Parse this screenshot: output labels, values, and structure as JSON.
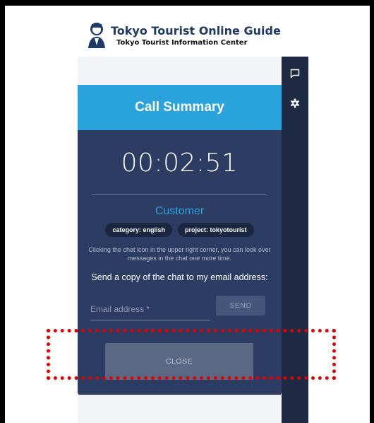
{
  "logo": {
    "title": "Tokyo Tourist Online Guide",
    "subtitle": "Tokyo Tourist Information Center"
  },
  "rail": {
    "chat_icon": "chat-bubble-icon",
    "settings_icon": "gear-icon"
  },
  "summary": {
    "title": "Call Summary",
    "duration": "00:02:51",
    "role": "Customer",
    "tags": [
      "category: english",
      "project: tokyotourist"
    ],
    "hint": "Clicking the chat icon in the upper right corner, you can look over messages in the chat one more time.",
    "send_copy_label": "Send a copy of the chat to my email address:",
    "email_placeholder": "Email address *",
    "email_value": "",
    "send_label": "SEND",
    "close_label": "CLOSE"
  },
  "colors": {
    "header": "#2aa3dc",
    "card": "#2c3c62",
    "rail": "#1e2a44",
    "highlight": "#e30000"
  }
}
